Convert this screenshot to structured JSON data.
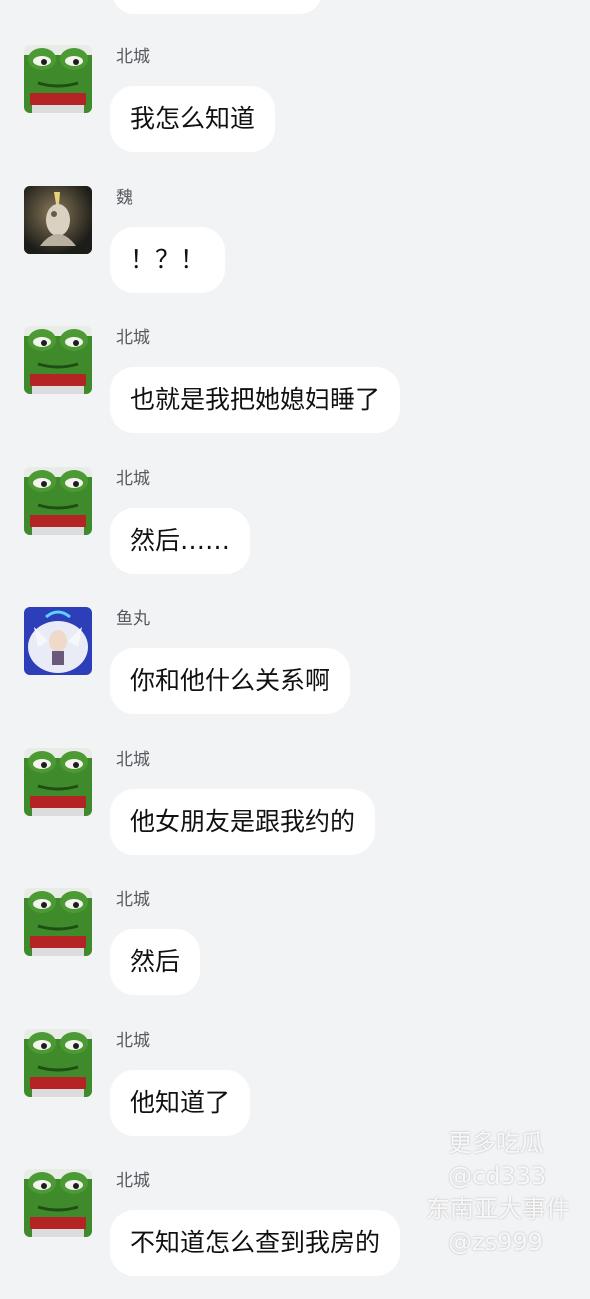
{
  "messages": [
    {
      "sender": "北城",
      "avatar": "frog-avatar-icon",
      "text": "我怎么知道"
    },
    {
      "sender": "魏",
      "avatar": "dark-character-avatar-icon",
      "text": "！？！"
    },
    {
      "sender": "北城",
      "avatar": "frog-avatar-icon",
      "text": "也就是我把她媳妇睡了"
    },
    {
      "sender": "北城",
      "avatar": "frog-avatar-icon",
      "text": "然后……"
    },
    {
      "sender": "鱼丸",
      "avatar": "anime-character-avatar-icon",
      "text": "你和他什么关系啊"
    },
    {
      "sender": "北城",
      "avatar": "frog-avatar-icon",
      "text": "他女朋友是跟我约的"
    },
    {
      "sender": "北城",
      "avatar": "frog-avatar-icon",
      "text": "然后"
    },
    {
      "sender": "北城",
      "avatar": "frog-avatar-icon",
      "text": "他知道了"
    },
    {
      "sender": "北城",
      "avatar": "frog-avatar-icon",
      "text": "不知道怎么查到我房的"
    }
  ],
  "watermark": {
    "line1": "更多吃瓜",
    "line2": "@cd333",
    "line3": "东南亚大事件",
    "line4": "@zs999"
  },
  "colors": {
    "background": "#f2f3f5",
    "bubble": "#ffffff",
    "frog_green": "#3f8a2a",
    "frog_scarf": "#b52424"
  }
}
